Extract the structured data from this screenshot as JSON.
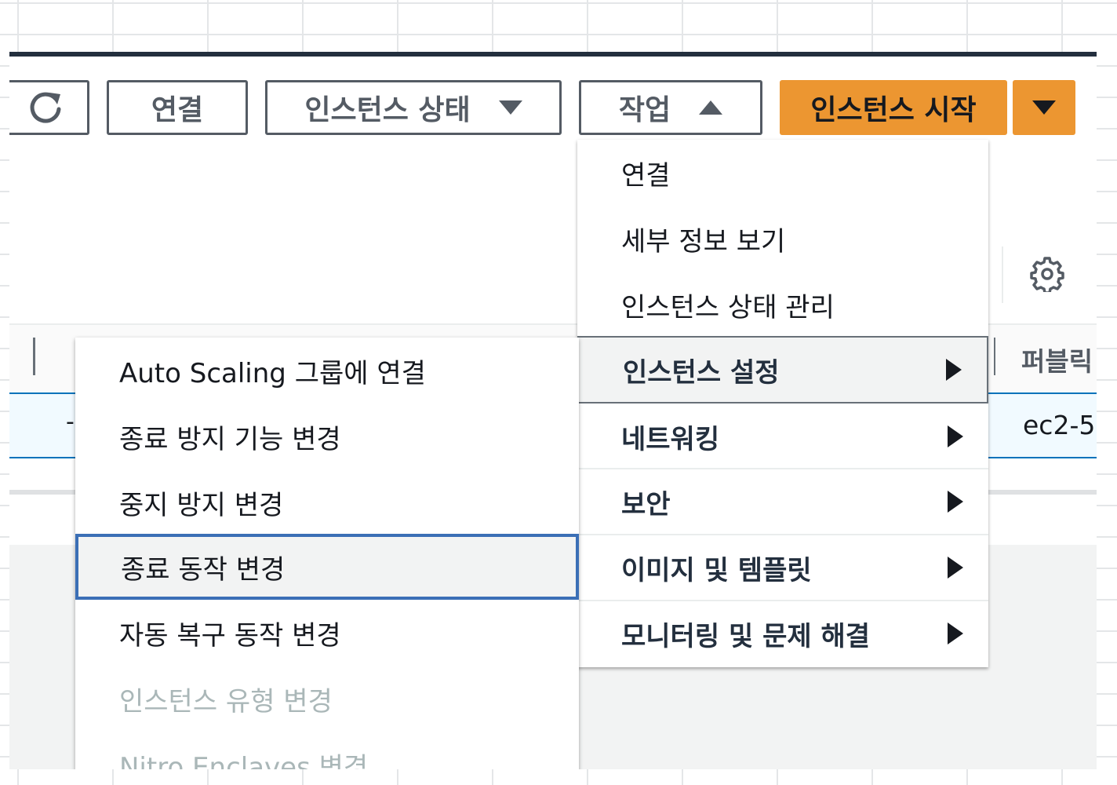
{
  "toolbar": {
    "refresh_icon": "refresh-icon",
    "connect_label": "연결",
    "instance_state_label": "인스턴스 상태",
    "actions_label": "작업",
    "launch_label": "인스턴스 시작",
    "primary_color": "#ec9631"
  },
  "table": {
    "header_public_col": "퍼블릭",
    "row_public_value": "ec2-5",
    "row_dash": "-",
    "selected_row_color": "#f1faff",
    "selected_border_color": "#0073bb"
  },
  "actions_menu": {
    "items": [
      {
        "label": "연결",
        "submenu": false
      },
      {
        "label": "세부 정보 보기",
        "submenu": false
      },
      {
        "label": "인스턴스 상태 관리",
        "submenu": false
      },
      {
        "label": "인스턴스 설정",
        "submenu": true,
        "active": true
      },
      {
        "label": "네트워킹",
        "submenu": true
      },
      {
        "label": "보안",
        "submenu": true
      },
      {
        "label": "이미지 및 템플릿",
        "submenu": true
      },
      {
        "label": "모니터링 및 문제 해결",
        "submenu": true
      }
    ]
  },
  "settings_submenu": {
    "items": [
      {
        "label": "Auto Scaling 그룹에 연결",
        "state": "enabled"
      },
      {
        "label": "종료 방지 기능 변경",
        "state": "enabled"
      },
      {
        "label": "중지 방지 변경",
        "state": "enabled"
      },
      {
        "label": "종료 동작 변경",
        "state": "focused"
      },
      {
        "label": "자동 복구 동작 변경",
        "state": "enabled"
      },
      {
        "label": "인스턴스 유형 변경",
        "state": "disabled"
      },
      {
        "label": "Nitro Enclaves 변경",
        "state": "disabled"
      }
    ],
    "focus_color": "#3b6fb6"
  }
}
